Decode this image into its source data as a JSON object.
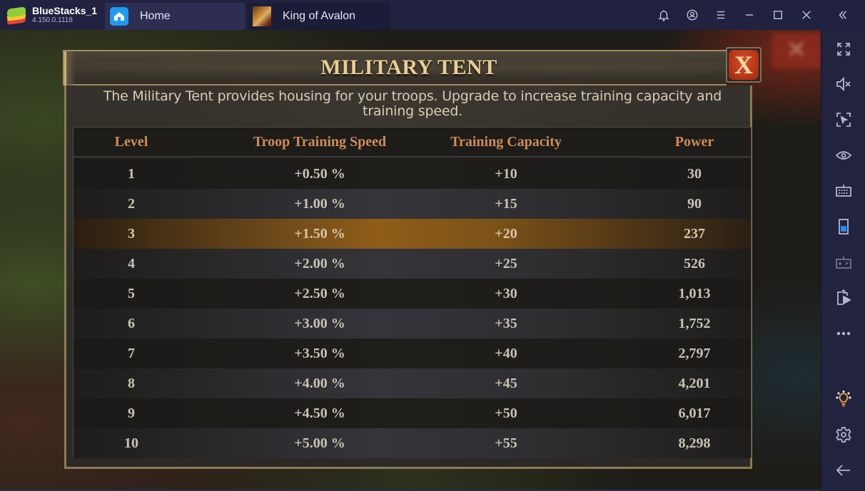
{
  "titlebar": {
    "app_name": "BlueStacks_1",
    "app_version": "4.150.0.1118",
    "tabs": [
      {
        "label": "Home",
        "icon": "home-icon"
      },
      {
        "label": "King of Avalon",
        "icon": "game-thumbnail-icon"
      }
    ],
    "controls": [
      "bell-icon",
      "account-icon",
      "menu-icon",
      "minimize-icon",
      "maximize-icon",
      "close-icon",
      "collapse-sidebar-icon"
    ]
  },
  "sidebar": {
    "items": [
      {
        "icon": "fullscreen-icon"
      },
      {
        "icon": "mute-icon"
      },
      {
        "icon": "screen-capture-icon"
      },
      {
        "icon": "eye-icon"
      },
      {
        "icon": "keyboard-icon"
      },
      {
        "icon": "device-rotate-icon"
      },
      {
        "icon": "gamepad-icon"
      },
      {
        "icon": "media-manager-icon"
      },
      {
        "icon": "more-icon"
      },
      {
        "icon": "lightbulb-icon",
        "color": "#f5a623"
      },
      {
        "icon": "settings-icon"
      },
      {
        "icon": "back-icon"
      }
    ]
  },
  "dialog": {
    "title": "MILITARY TENT",
    "close_label": "X",
    "description": "The Military Tent provides housing for your troops. Upgrade to increase training capacity and training speed.",
    "headers": [
      "Level",
      "Troop Training Speed",
      "Training Capacity",
      "Power"
    ],
    "highlighted_level": 3,
    "rows": [
      {
        "level": "1",
        "speed": "+0.50 %",
        "capacity": "+10",
        "power": "30"
      },
      {
        "level": "2",
        "speed": "+1.00 %",
        "capacity": "+15",
        "power": "90"
      },
      {
        "level": "3",
        "speed": "+1.50 %",
        "capacity": "+20",
        "power": "237"
      },
      {
        "level": "4",
        "speed": "+2.00 %",
        "capacity": "+25",
        "power": "526"
      },
      {
        "level": "5",
        "speed": "+2.50 %",
        "capacity": "+30",
        "power": "1,013"
      },
      {
        "level": "6",
        "speed": "+3.00 %",
        "capacity": "+35",
        "power": "1,752"
      },
      {
        "level": "7",
        "speed": "+3.50 %",
        "capacity": "+40",
        "power": "2,797"
      },
      {
        "level": "8",
        "speed": "+4.00 %",
        "capacity": "+45",
        "power": "4,201"
      },
      {
        "level": "9",
        "speed": "+4.50 %",
        "capacity": "+50",
        "power": "6,017"
      },
      {
        "level": "10",
        "speed": "+5.00 %",
        "capacity": "+55",
        "power": "8,298"
      }
    ]
  },
  "colors": {
    "header_text": "#d08c54",
    "title_text": "#e8cf95",
    "highlight_row": "#8f5d18",
    "close_button": "#c0401e"
  }
}
